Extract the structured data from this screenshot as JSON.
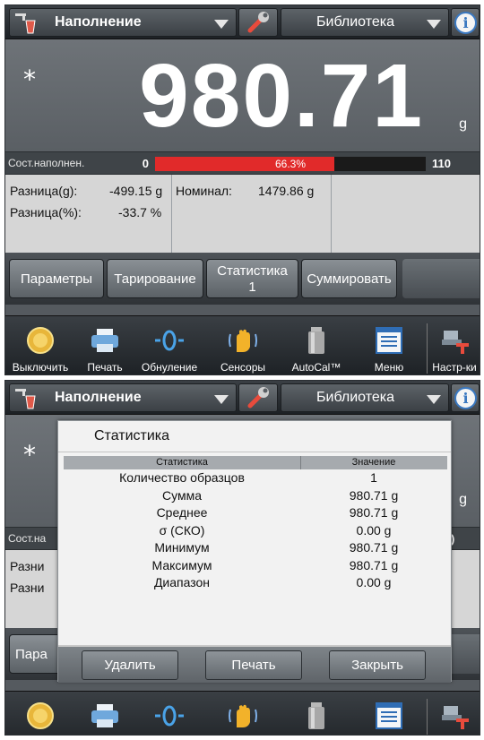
{
  "panel1": {
    "header": {
      "app_name": "Наполнение",
      "library": "Библиотека"
    },
    "display": {
      "stable_indicator": "*",
      "reading": "980.71",
      "unit": "g"
    },
    "fill": {
      "label": "Сост.наполнен.",
      "min": "0",
      "percent_text": "66.3%",
      "percent": 66.3,
      "max": "110"
    },
    "info": {
      "diff_g_label": "Разница(g):",
      "diff_g_value": "-499.15 g",
      "diff_pct_label": "Разница(%):",
      "diff_pct_value": "-33.7 %",
      "nominal_label": "Номинал:",
      "nominal_value": "1479.86 g"
    },
    "softkeys": {
      "params": "Параметры",
      "tare": "Тарирование",
      "stats_line1": "Статистика",
      "stats_line2": "1",
      "sum": "Суммировать"
    }
  },
  "panel2": {
    "header": {
      "app_name": "Наполнение",
      "library": "Библиотека"
    },
    "background": {
      "stable_indicator": "*",
      "unit": "g",
      "fill_label_partial": "Сост.на",
      "fill_max_partial": ")",
      "info1_partial": "Разни",
      "info2_partial": "Разни",
      "softkey_partial": "Пара"
    },
    "dialog": {
      "title": "Статистика",
      "col_stat": "Статистика",
      "col_value": "Значение",
      "rows": [
        {
          "label": "Количество образцов",
          "value": "1"
        },
        {
          "label": "Сумма",
          "value": "980.71 g"
        },
        {
          "label": "Среднее",
          "value": "980.71 g"
        },
        {
          "label": "σ (СКО)",
          "value": "0.00 g"
        },
        {
          "label": "Минимум",
          "value": "980.71 g"
        },
        {
          "label": "Максимум",
          "value": "980.71 g"
        },
        {
          "label": "Диапазон",
          "value": "0.00 g"
        }
      ],
      "buttons": {
        "delete": "Удалить",
        "print": "Печать",
        "close": "Закрыть"
      }
    }
  },
  "nav": {
    "off": "Выключить",
    "print": "Печать",
    "zero": "Обнуление",
    "sensors": "Сенсоры",
    "autocal": "AutoCal™",
    "menu": "Меню",
    "setup": "Настр-ки"
  },
  "colors": {
    "fill_red": "#e12a2a",
    "info_blue": "#3a78c0",
    "background_dark": "#555a5f"
  }
}
